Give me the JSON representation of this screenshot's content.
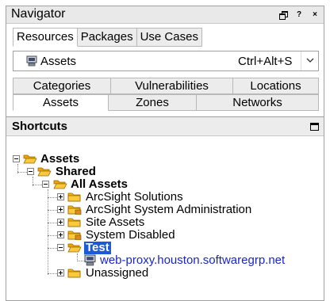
{
  "window": {
    "title": "Navigator",
    "restore_label": "",
    "help_label": "?",
    "close_label": "×"
  },
  "top_tabs": [
    "Resources",
    "Packages",
    "Use Cases"
  ],
  "selector": {
    "label": "Assets",
    "shortcut": "Ctrl+Alt+S",
    "icon": "computer-icon"
  },
  "tab_rows": {
    "back": [
      "Categories",
      "Vulnerabilities",
      "Locations"
    ],
    "front": [
      "Assets",
      "Zones",
      "Networks"
    ]
  },
  "shortcuts": {
    "title": "Shortcuts"
  },
  "tree": {
    "root": "Assets",
    "shared": "Shared",
    "all_assets": "All Assets",
    "groups": [
      "ArcSight Solutions",
      "ArcSight System Administration",
      "Site Assets",
      "System Disabled",
      "Test",
      "Unassigned"
    ],
    "test_child": "web-proxy.houston.softwaregrp.net"
  },
  "colors": {
    "folder": "#f5b20c",
    "selection": "#1c5ad7",
    "link": "#1a25c8",
    "lock": "#d98a1a"
  }
}
